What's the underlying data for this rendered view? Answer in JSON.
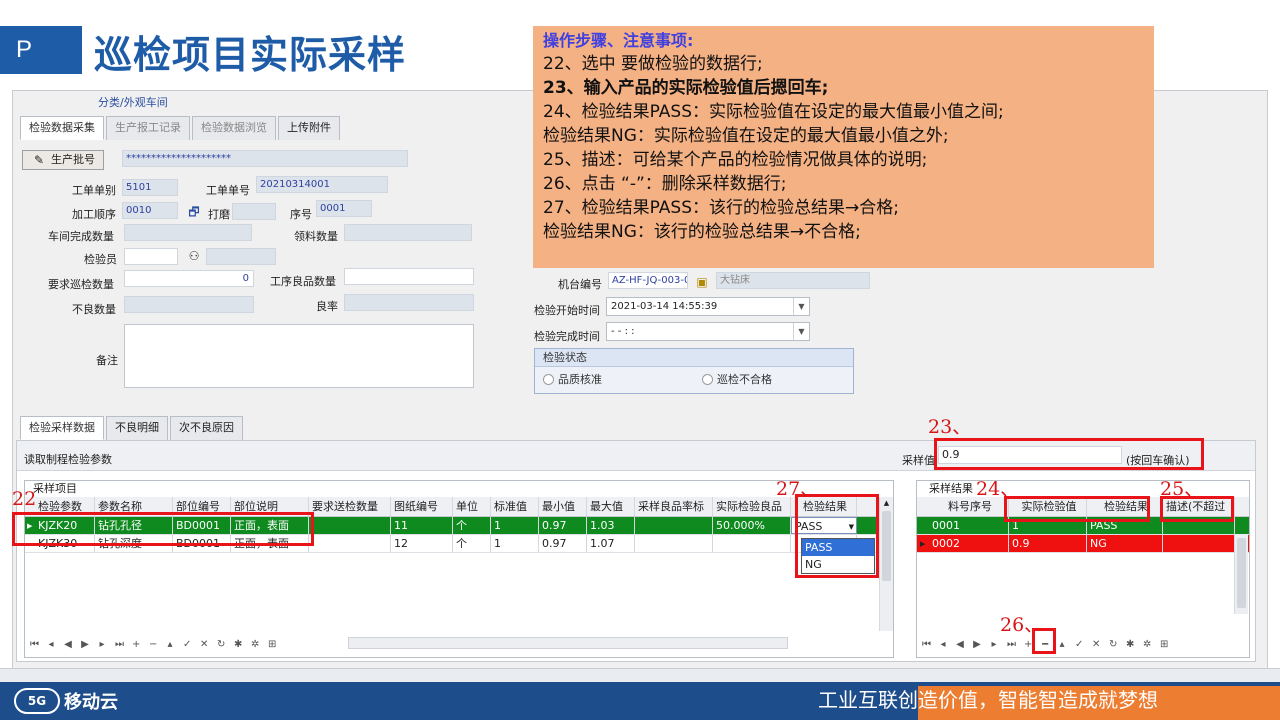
{
  "slide": {
    "badge": "P",
    "title": "巡检项目实际采样"
  },
  "breadcrumb": "分类/外观车间",
  "top_tabs": [
    "检验数据采集",
    "生产报工记录",
    "检验数据浏览",
    "上传附件"
  ],
  "form": {
    "batch_button": "生产批号",
    "batch_value": "*********************",
    "order_type_label": "工单单别",
    "order_type_value": "5101",
    "order_no_label": "工单单号",
    "order_no_value": "20210314001",
    "process_seq_label": "加工顺序",
    "process_seq_value": "0010",
    "process_name": "打磨",
    "seq_label": "序号",
    "seq_value": "0001",
    "shop_done_label": "车间完成数量",
    "picked_qty_label": "领料数量",
    "inspector_label": "检验员",
    "req_qty_label": "要求巡检数量",
    "req_qty_value": "0",
    "good_qty_label": "工序良品数量",
    "bad_qty_label": "不良数量",
    "yield_label": "良率",
    "remark_label": "备注",
    "machine_label": "机台编号",
    "machine_value": "AZ-HF-JQ-003-0",
    "machine_name": "大钻床",
    "start_label": "检验开始时间",
    "start_value": "2021-03-14 14:55:39",
    "end_label": "检验完成时间",
    "end_value": "- -   : :",
    "status_title": "检验状态",
    "status_opt1": "品质核准",
    "status_opt2": "巡检不合格"
  },
  "bottom_tabs": [
    "检验采样数据",
    "不良明细",
    "次不良原因"
  ],
  "read_params_label": "读取制程检验参数",
  "sample_input": {
    "label": "采样值",
    "value": "0.9",
    "hint": "(按回车确认)"
  },
  "left_grid": {
    "title": "采样项目",
    "columns": [
      "检验参数",
      "参数名称",
      "部位编号",
      "部位说明",
      "要求送检数量",
      "图纸编号",
      "单位",
      "标准值",
      "最小值",
      "最大值",
      "采样良品率标",
      "实际检验良品",
      "检验结果"
    ],
    "rows": [
      [
        "KJZK20",
        "钻孔孔径",
        "BD0001",
        "正面，表面",
        "",
        "11",
        "个",
        "1",
        "0.97",
        "1.03",
        "",
        "50.000%",
        "PASS"
      ],
      [
        "KJZK30",
        "钻孔深度",
        "BD0001",
        "正面，表面",
        "",
        "12",
        "个",
        "1",
        "0.97",
        "1.07",
        "",
        "",
        ""
      ]
    ],
    "dropdown_options": [
      "PASS",
      "NG"
    ]
  },
  "right_grid": {
    "title": "采样结果",
    "columns": [
      "料号序号",
      "实际检验值",
      "检验结果",
      "描述(不超过"
    ],
    "rows": [
      [
        "0001",
        "1",
        "PASS",
        ""
      ],
      [
        "0002",
        "0.9",
        "NG",
        ""
      ]
    ]
  },
  "annotations": [
    "22",
    "23、",
    "24、",
    "25、",
    "26、",
    "27、"
  ],
  "notes": {
    "heading": "操作步骤、注意事项:",
    "lines": [
      "22、选中 要做检验的数据行;",
      "23、输入产品的实际检验值后摁回车;",
      "24、检验结果PASS：实际检验值在设定的最大值最小值之间;",
      "检验结果NG：实际检验值在设定的最大值最小值之外;",
      "25、描述：可给某个产品的检验情况做具体的说明;",
      "26、点击 “-”：删除采样数据行;",
      "27、检验结果PASS：该行的检验总结果→合格;",
      "检验结果NG：该行的检验总结果→不合格;"
    ]
  },
  "footer": {
    "logo_text": "移动云",
    "logo_mark": "5G",
    "slogan": "工业互联创造价值，智能智造成就梦想"
  },
  "colors": {
    "brand_blue": "#1f5ca8",
    "note_bg": "#f4b183",
    "pass_row": "#0f8a1f",
    "ng_row": "#ef1010",
    "annotation_red": "#e8141a",
    "footer_orange": "#ec7d31"
  }
}
